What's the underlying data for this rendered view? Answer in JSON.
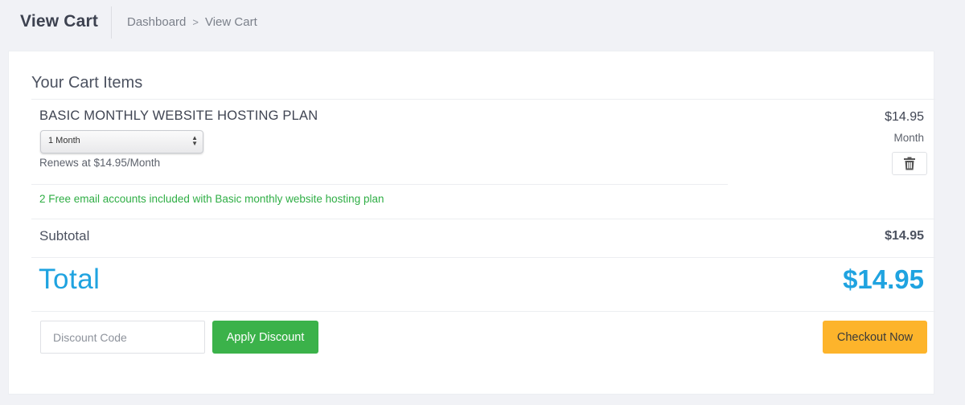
{
  "header": {
    "title": "View Cart",
    "breadcrumb": [
      {
        "label": "Dashboard"
      },
      {
        "label": "View Cart"
      }
    ],
    "breadcrumb_separator": ">"
  },
  "cart": {
    "section_title": "Your Cart Items",
    "items": [
      {
        "name": "BASIC MONTHLY WEBSITE HOSTING PLAN",
        "billing_cycle_selected": "1 Month",
        "renews_text": "Renews at $14.95/Month",
        "price": "$14.95",
        "period": "Month",
        "remove_icon": "trash-icon",
        "promo_note": "2 Free email accounts included with Basic monthly website hosting plan"
      }
    ],
    "subtotal_label": "Subtotal",
    "subtotal_value": "$14.95",
    "total_label": "Total",
    "total_value": "$14.95"
  },
  "discount": {
    "placeholder": "Discount Code",
    "value": "",
    "apply_label": "Apply Discount"
  },
  "checkout": {
    "label": "Checkout Now"
  },
  "colors": {
    "accent_total": "#1fa3e0",
    "promo_green": "#2fae45",
    "apply_green": "#3bb24a",
    "checkout_amber": "#fdb42b"
  }
}
